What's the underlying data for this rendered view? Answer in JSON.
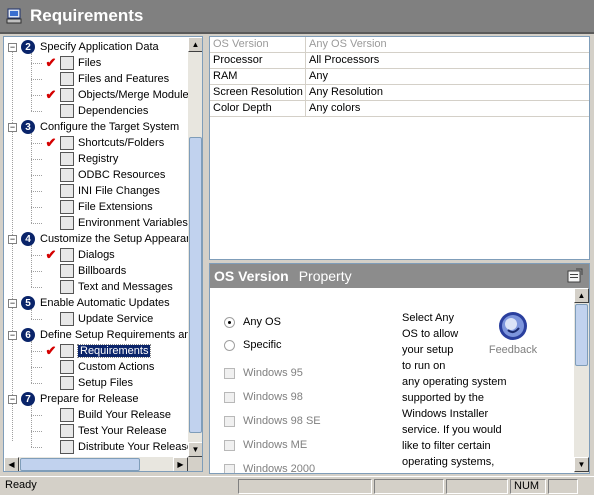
{
  "window": {
    "title": "Requirements"
  },
  "tree": {
    "groups": [
      {
        "number": "2",
        "label": "Specify Application Data",
        "items": [
          {
            "label": "Files",
            "checked": true,
            "icon": "files-icon"
          },
          {
            "label": "Files and Features",
            "checked": false,
            "icon": "files-features-icon"
          },
          {
            "label": "Objects/Merge Modules",
            "checked": true,
            "icon": "objects-icon"
          },
          {
            "label": "Dependencies",
            "checked": false,
            "icon": "dependencies-icon"
          }
        ]
      },
      {
        "number": "3",
        "label": "Configure the Target System",
        "items": [
          {
            "label": "Shortcuts/Folders",
            "checked": true,
            "icon": "shortcuts-icon"
          },
          {
            "label": "Registry",
            "checked": false,
            "icon": "registry-icon"
          },
          {
            "label": "ODBC Resources",
            "checked": false,
            "icon": "odbc-icon"
          },
          {
            "label": "INI File Changes",
            "checked": false,
            "icon": "ini-icon"
          },
          {
            "label": "File Extensions",
            "checked": false,
            "icon": "extensions-icon"
          },
          {
            "label": "Environment Variables",
            "checked": false,
            "icon": "env-icon"
          }
        ]
      },
      {
        "number": "4",
        "label": "Customize the Setup Appearance",
        "items": [
          {
            "label": "Dialogs",
            "checked": true,
            "icon": "dialogs-icon"
          },
          {
            "label": "Billboards",
            "checked": false,
            "icon": "billboards-icon"
          },
          {
            "label": "Text and Messages",
            "checked": false,
            "icon": "text-icon"
          }
        ]
      },
      {
        "number": "5",
        "label": "Enable Automatic Updates",
        "items": [
          {
            "label": "Update Service",
            "checked": false,
            "icon": "update-icon"
          }
        ]
      },
      {
        "number": "6",
        "label": "Define Setup Requirements and Actions",
        "items": [
          {
            "label": "Requirements",
            "checked": true,
            "icon": "requirements-icon",
            "selected": true
          },
          {
            "label": "Custom Actions",
            "checked": false,
            "icon": "custom-actions-icon"
          },
          {
            "label": "Setup Files",
            "checked": false,
            "icon": "setup-files-icon"
          }
        ]
      },
      {
        "number": "7",
        "label": "Prepare for Release",
        "items": [
          {
            "label": "Build Your Release",
            "checked": false,
            "icon": "build-icon"
          },
          {
            "label": "Test Your Release",
            "checked": false,
            "icon": "test-icon"
          },
          {
            "label": "Distribute Your Release",
            "checked": false,
            "icon": "distribute-icon"
          }
        ]
      }
    ]
  },
  "grid": {
    "rows": [
      {
        "key": "OS Version",
        "value": "Any OS Version",
        "disabled": true
      },
      {
        "key": "Processor",
        "value": "All Processors",
        "disabled": false
      },
      {
        "key": "RAM",
        "value": "Any",
        "disabled": false
      },
      {
        "key": "Screen Resolution",
        "value": "Any Resolution",
        "disabled": false
      },
      {
        "key": "Color Depth",
        "value": "Any colors",
        "disabled": false
      }
    ]
  },
  "help": {
    "heading": "OS Version",
    "subheading": "Property",
    "radios": [
      {
        "label": "Any OS",
        "selected": true
      },
      {
        "label": "Specific",
        "selected": false
      }
    ],
    "checkboxes": [
      "Windows 95",
      "Windows 98",
      "Windows 98 SE",
      "Windows ME",
      "Windows 2000"
    ],
    "description": "Select Any OS to allow your setup to run on any operating system supported by the Windows Installer service. If you would like to filter certain operating systems,",
    "desc_lines": [
      "Select Any",
      "OS to allow",
      "your setup",
      "to run on",
      "any operating system",
      "supported by the",
      "Windows Installer",
      "service. If you would",
      "like to filter certain",
      "operating systems,"
    ],
    "feedback_label": "Feedback"
  },
  "status": {
    "text": "Ready",
    "num": "NUM"
  }
}
